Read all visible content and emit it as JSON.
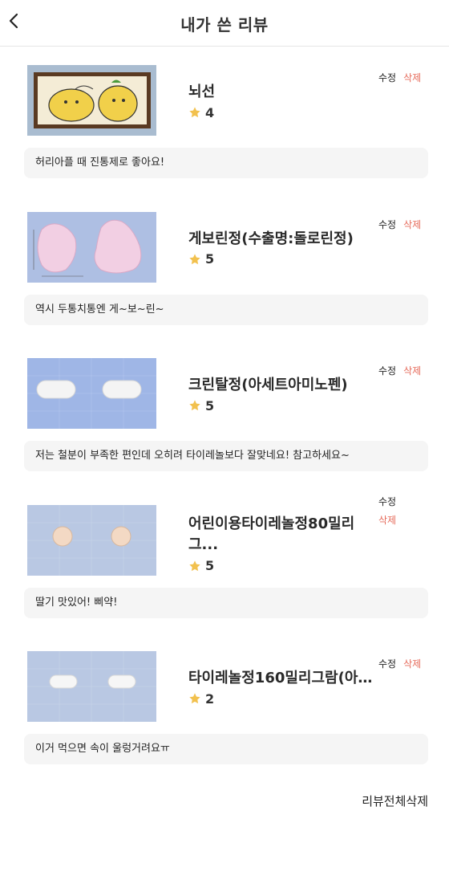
{
  "header": {
    "title": "내가 쓴 리뷰",
    "back_icon": "chevron-left-icon"
  },
  "reviews": [
    {
      "name": "뇌선",
      "rating": "4",
      "edit_label": "수정",
      "delete_label": "삭제",
      "comment": "허리아플 때 진통제로 좋아요!",
      "image": "cartoon-frame"
    },
    {
      "name": "게보린정(수출명:돌로린정)",
      "rating": "5",
      "edit_label": "수정",
      "delete_label": "삭제",
      "comment": "역시 두통치통엔 게~보~린~",
      "image": "pink-pill"
    },
    {
      "name": "크린탈정(아세트아미노펜)",
      "rating": "5",
      "edit_label": "수정",
      "delete_label": "삭제",
      "comment": "저는 철분이 부족한 편인데 오히려 타이레놀보다 잘맞네요! 참고하세요~",
      "image": "white-capsule-blue"
    },
    {
      "name": "어린이용타이레놀정80밀리그...",
      "rating": "5",
      "edit_label": "수정",
      "delete_label": "삭제",
      "comment": "딸기 맛있어! 삐약!",
      "image": "round-pill"
    },
    {
      "name": "타이레놀정160밀리그람(아...",
      "rating": "2",
      "edit_label": "수정",
      "delete_label": "삭제",
      "comment": "이거 먹으면 속이 울렁거려요ㅠ",
      "image": "white-capsule"
    }
  ],
  "footer": {
    "delete_all_label": "리뷰전체삭제"
  },
  "colors": {
    "accent_delete": "#e66b5b",
    "star": "#f2c14e",
    "comment_bg": "#f5f5f5"
  }
}
